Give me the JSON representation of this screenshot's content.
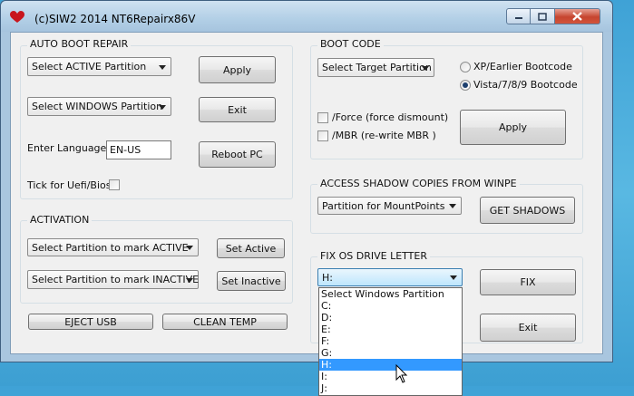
{
  "window": {
    "title": "(c)SIW2 2014 NT6Repairx86V"
  },
  "auto_boot_repair": {
    "title": "AUTO BOOT REPAIR",
    "active_partition_combo": "Select ACTIVE Partition",
    "windows_partition_combo": "Select WINDOWS Partition",
    "enter_language_label": "Enter Language:",
    "language_value": "EN-US",
    "uefi_label": "Tick for Uefi/Bios",
    "apply_button": "Apply",
    "exit_button": "Exit",
    "reboot_button": "Reboot PC"
  },
  "boot_code": {
    "title": "BOOT CODE",
    "target_partition_combo": "Select Target Partition",
    "radio_xp": "XP/Earlier Bootcode",
    "radio_vista": "Vista/7/8/9 Bootcode",
    "force_label": "/Force (force dismount)",
    "mbr_label": "/MBR (re-write MBR )",
    "apply_button": "Apply"
  },
  "activation": {
    "title": "ACTIVATION",
    "active_combo": "Select Partition to mark ACTIVE",
    "inactive_combo": "Select Partition to mark INACTIVE",
    "set_active_button": "Set Active",
    "set_inactive_button": "Set Inactive"
  },
  "bottom": {
    "eject_usb_button": "EJECT USB",
    "clean_temp_button": "CLEAN TEMP"
  },
  "shadow": {
    "title": "ACCESS SHADOW COPIES FROM WINPE",
    "partition_combo": "Partition for MountPoints",
    "get_shadows_button": "GET SHADOWS"
  },
  "fix_os": {
    "title": "FIX OS DRIVE LETTER",
    "drive_combo": "H:",
    "fix_button": "FIX",
    "exit_button": "Exit",
    "options": [
      "Select Windows Partition",
      "C:",
      "D:",
      "E:",
      "F:",
      "G:",
      "H:",
      "I:",
      "J:"
    ],
    "selected_index": 6
  }
}
